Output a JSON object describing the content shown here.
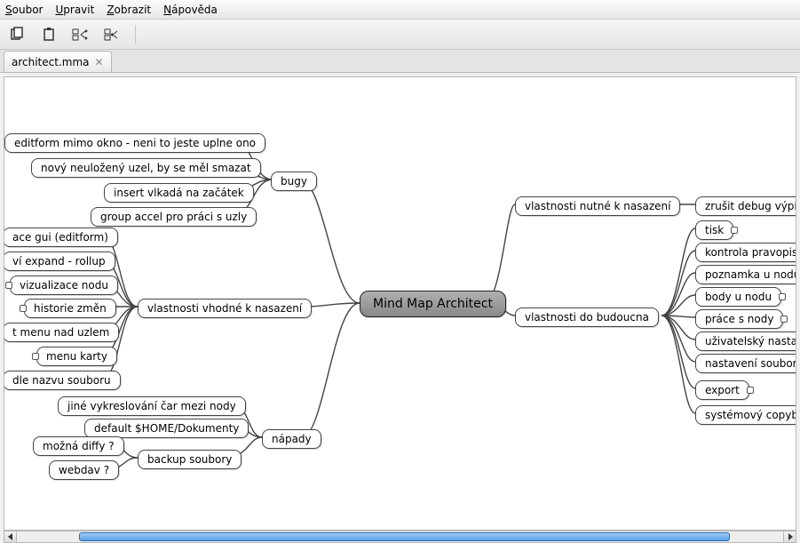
{
  "menubar": [
    {
      "accel": "S",
      "rest": "oubor"
    },
    {
      "accel": "U",
      "rest": "pravit"
    },
    {
      "accel": "Z",
      "rest": "obrazit"
    },
    {
      "accel": "N",
      "rest": "ápověda"
    }
  ],
  "toolbar": {
    "buttons": [
      "copy-icon",
      "paste-icon",
      "expand-all-icon",
      "collapse-all-icon"
    ]
  },
  "tab": {
    "title": "architect.mma"
  },
  "root": {
    "label": "Mind Map Architect"
  },
  "left_branches": {
    "bugy": {
      "label": "bugy",
      "children": [
        "editform mimo okno - neni to jeste uplne ono",
        "nový neuložený uzel, by se měl smazat",
        "insert vlkadá na začátek",
        "group accel pro práci s uzly"
      ]
    },
    "vlastnosti_vhodne": {
      "label": "vlastnosti vhodné k nasazení",
      "children": [
        "ace gui (editform)",
        "ví expand - rollup",
        "vizualizace nodu",
        "historie změn",
        "t menu nad uzlem",
        "menu karty",
        "dle nazvu souboru"
      ]
    },
    "napady": {
      "label": "nápady",
      "children_direct": [
        "jiné vykreslování čar mezi nody",
        "default $HOME/Dokumenty"
      ],
      "backup": {
        "label": "backup soubory",
        "children": [
          "možná diffy ?",
          "webdav ?"
        ]
      }
    }
  },
  "right_branches": {
    "nutne": {
      "label": "vlastnosti nutné k nasazení",
      "children": [
        "zrušit debug výpisy"
      ]
    },
    "budoucna": {
      "label": "vlastnosti do budoucna",
      "children": [
        "tisk",
        "kontrola pravopisu",
        "poznamka u nodu",
        "body u nodu",
        "práce s nody",
        "uživatelský nastave",
        "nastavení souboru",
        "export",
        "systémový copybor"
      ]
    }
  }
}
